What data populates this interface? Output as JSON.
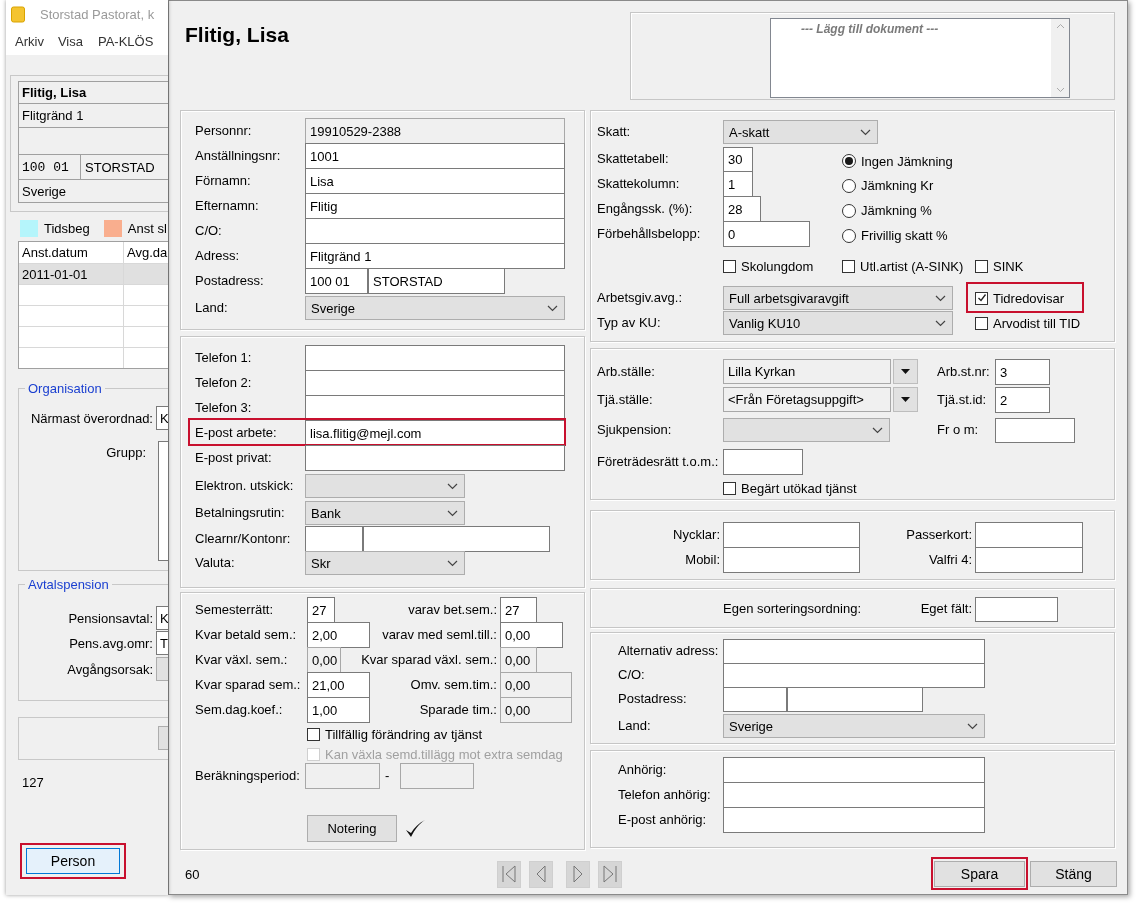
{
  "background_window": {
    "title": "Storstad Pastorat, k",
    "menu": [
      "Arkiv",
      "Visa",
      "PA-KLÖS"
    ],
    "address_card": {
      "name": "Flitig, Lisa",
      "street": "Flitgränd 1",
      "postcode": "100 01",
      "city": "STORSTAD",
      "country": "Sverige"
    },
    "legend": [
      {
        "label": "Tidsbeg",
        "color": "#b5f5fb"
      },
      {
        "label": "Anst sl",
        "color": "#f9ae8e"
      }
    ],
    "table": {
      "columns": [
        "Anst.datum",
        "Avg.da"
      ],
      "rows": [
        {
          "cells": [
            "2011-01-01"
          ],
          "selected": true
        }
      ]
    },
    "groups": [
      {
        "title": "Organisation",
        "fields": [
          {
            "label": "Närmast överordnad:",
            "kind": "text",
            "value": "K"
          },
          {
            "label": "Grupp:",
            "kind": "list"
          }
        ]
      },
      {
        "title": "Avtalspension",
        "fields": [
          {
            "label": "Pensionsavtal:",
            "kind": "text",
            "value": "K"
          },
          {
            "label": "Pens.avg.omr:",
            "kind": "text",
            "value": "T"
          },
          {
            "label": "Avgångsorsak:",
            "kind": "combo"
          }
        ]
      }
    ],
    "count": "127",
    "button": {
      "label": "Person",
      "highlighted": true
    }
  },
  "dialog": {
    "title": "Flitig, Lisa",
    "documents": [
      "--- Lägg till dokument ---"
    ],
    "left_panels": [
      {
        "rows": [
          {
            "items": [
              {
                "kind": "label",
                "text": "Personnr:"
              },
              {
                "kind": "readonly",
                "value": "19910529-2388"
              }
            ]
          },
          {
            "items": [
              {
                "kind": "label",
                "text": "Anställningsnr:"
              },
              {
                "kind": "text",
                "value": "1001"
              }
            ]
          },
          {
            "items": [
              {
                "kind": "label",
                "text": "Förnamn:"
              },
              {
                "kind": "text",
                "value": "Lisa"
              }
            ]
          },
          {
            "items": [
              {
                "kind": "label",
                "text": "Efternamn:"
              },
              {
                "kind": "text",
                "value": "Flitig"
              }
            ]
          },
          {
            "items": [
              {
                "kind": "label",
                "text": "C/O:"
              },
              {
                "kind": "text"
              }
            ]
          },
          {
            "items": [
              {
                "kind": "label",
                "text": "Adress:"
              },
              {
                "kind": "text",
                "value": "Flitgränd 1"
              }
            ]
          },
          {
            "items": [
              {
                "kind": "label",
                "text": "Postadress:"
              },
              {
                "kind": "text",
                "value": "100 01"
              },
              {
                "kind": "text",
                "value": "STORSTAD"
              }
            ]
          },
          {
            "items": [
              {
                "kind": "label",
                "text": "Land:"
              },
              {
                "kind": "combo",
                "value": "Sverige"
              }
            ]
          }
        ]
      },
      {
        "rows": [
          {
            "items": [
              {
                "kind": "label",
                "text": "Telefon 1:"
              },
              {
                "kind": "text"
              }
            ]
          },
          {
            "items": [
              {
                "kind": "label",
                "text": "Telefon 2:"
              },
              {
                "kind": "text"
              }
            ]
          },
          {
            "items": [
              {
                "kind": "label",
                "text": "Telefon 3:"
              },
              {
                "kind": "text"
              }
            ]
          },
          {
            "highlighted": true,
            "items": [
              {
                "kind": "label",
                "text": "E-post arbete:"
              },
              {
                "kind": "text",
                "value": "lisa.flitig@mejl.com"
              }
            ]
          },
          {
            "items": [
              {
                "kind": "label",
                "text": "E-post privat:"
              },
              {
                "kind": "text"
              }
            ]
          },
          {
            "items": [
              {
                "kind": "label",
                "text": "Elektron. utskick:"
              },
              {
                "kind": "combo"
              }
            ]
          },
          {
            "items": [
              {
                "kind": "label",
                "text": "Betalningsrutin:"
              },
              {
                "kind": "combo",
                "value": "Bank"
              }
            ]
          },
          {
            "items": [
              {
                "kind": "label",
                "text": "Clearnr/Kontonr:"
              },
              {
                "kind": "text"
              },
              {
                "kind": "text"
              }
            ]
          },
          {
            "items": [
              {
                "kind": "label",
                "text": "Valuta:"
              },
              {
                "kind": "combo",
                "value": "Skr"
              }
            ]
          }
        ]
      },
      {
        "rows": [
          {
            "items": [
              {
                "kind": "label",
                "text": "Semesterrätt:"
              },
              {
                "kind": "text",
                "value": "27"
              },
              {
                "kind": "label",
                "text": "varav bet.sem.:"
              },
              {
                "kind": "text",
                "value": "27"
              }
            ]
          },
          {
            "items": [
              {
                "kind": "label",
                "text": "Kvar betald sem.:"
              },
              {
                "kind": "text",
                "value": "2,00"
              },
              {
                "kind": "label",
                "text": "varav med seml.till.:"
              },
              {
                "kind": "text",
                "value": "0,00"
              }
            ]
          },
          {
            "items": [
              {
                "kind": "label",
                "text": "Kvar växl. sem.:"
              },
              {
                "kind": "readonly",
                "value": "0,00"
              },
              {
                "kind": "label",
                "text": "Kvar sparad växl. sem.:"
              },
              {
                "kind": "readonly",
                "value": "0,00"
              }
            ]
          },
          {
            "items": [
              {
                "kind": "label",
                "text": "Kvar sparad sem.:"
              },
              {
                "kind": "text",
                "value": "21,00"
              },
              {
                "kind": "label",
                "text": "Omv. sem.tim.:"
              },
              {
                "kind": "readonly",
                "value": "0,00"
              }
            ]
          },
          {
            "items": [
              {
                "kind": "label",
                "text": "Sem.dag.koef.:"
              },
              {
                "kind": "text",
                "value": "1,00"
              },
              {
                "kind": "label",
                "text": "Sparade tim.:"
              },
              {
                "kind": "readonly",
                "value": "0,00"
              }
            ]
          },
          {
            "items": [
              {
                "kind": "checkbox",
                "label": "Tillfällig förändring av tjänst",
                "checked": false,
                "disabled": false
              }
            ]
          },
          {
            "items": [
              {
                "kind": "checkbox",
                "label": "Kan växla semd.tillägg mot extra semdag",
                "checked": false,
                "disabled": true
              }
            ]
          },
          {
            "items": [
              {
                "kind": "label",
                "text": "Beräkningsperiod:"
              },
              {
                "kind": "readonly"
              },
              {
                "kind": "label",
                "text": "-"
              },
              {
                "kind": "readonly"
              }
            ]
          },
          {
            "items": [
              {
                "kind": "button",
                "label": "Notering",
                "noted": true
              }
            ]
          }
        ]
      }
    ],
    "right_panels": [
      {
        "rows": [
          {
            "items": [
              {
                "kind": "label",
                "text": "Skatt:"
              },
              {
                "kind": "combo",
                "value": "A-skatt"
              }
            ]
          },
          {
            "items": [
              {
                "kind": "label",
                "text": "Skattetabell:"
              },
              {
                "kind": "text",
                "value": "30"
              },
              {
                "kind": "radio",
                "label": "Ingen Jämkning",
                "selected": true
              }
            ]
          },
          {
            "items": [
              {
                "kind": "label",
                "text": "Skattekolumn:"
              },
              {
                "kind": "text",
                "value": "1"
              },
              {
                "kind": "radio",
                "label": "Jämkning Kr",
                "selected": false
              }
            ]
          },
          {
            "items": [
              {
                "kind": "label",
                "text": "Engångssk. (%):"
              },
              {
                "kind": "text",
                "value": "28"
              },
              {
                "kind": "radio",
                "label": "Jämkning %",
                "selected": false
              }
            ]
          },
          {
            "items": [
              {
                "kind": "label",
                "text": "Förbehållsbelopp:"
              },
              {
                "kind": "text",
                "value": "0"
              },
              {
                "kind": "radio",
                "label": "Frivillig skatt %",
                "selected": false
              }
            ]
          },
          {
            "items": [
              {
                "kind": "checkbox",
                "label": "Skolungdom",
                "checked": false,
                "disabled": false
              },
              {
                "kind": "checkbox",
                "label": "Utl.artist (A-SINK)",
                "checked": false,
                "disabled": false
              },
              {
                "kind": "checkbox",
                "label": "SINK",
                "checked": false,
                "disabled": false
              }
            ]
          },
          {
            "items": [
              {
                "kind": "label",
                "text": "Arbetsgiv.avg.:"
              },
              {
                "kind": "combo",
                "value": "Full arbetsgivaravgift"
              },
              {
                "kind": "checkbox",
                "label": "Tidredovisar",
                "checked": true,
                "disabled": false,
                "highlighted": true
              }
            ]
          },
          {
            "items": [
              {
                "kind": "label",
                "text": "Typ av KU:"
              },
              {
                "kind": "combo",
                "value": "Vanlig KU10"
              },
              {
                "kind": "checkbox",
                "label": "Arvodist till TID",
                "checked": false,
                "disabled": false
              }
            ]
          }
        ]
      },
      {
        "rows": [
          {
            "items": [
              {
                "kind": "label",
                "text": "Arb.ställe:"
              },
              {
                "kind": "picker",
                "value": "Lilla Kyrkan"
              },
              {
                "kind": "label",
                "text": "Arb.st.nr:"
              },
              {
                "kind": "text",
                "value": "3"
              }
            ]
          },
          {
            "items": [
              {
                "kind": "label",
                "text": "Tjä.ställe:"
              },
              {
                "kind": "picker",
                "value": "<Från Företagsuppgift>"
              },
              {
                "kind": "label",
                "text": "Tjä.st.id:"
              },
              {
                "kind": "text",
                "value": "2"
              }
            ]
          },
          {
            "items": [
              {
                "kind": "label",
                "text": "Sjukpension:"
              },
              {
                "kind": "combo"
              },
              {
                "kind": "label",
                "text": "Fr o m:"
              },
              {
                "kind": "text"
              }
            ]
          },
          {
            "items": [
              {
                "kind": "label",
                "text": "Företrädesrätt t.o.m.:"
              },
              {
                "kind": "text"
              }
            ]
          },
          {
            "items": [
              {
                "kind": "checkbox",
                "label": "Begärt utökad tjänst",
                "checked": false,
                "disabled": false
              }
            ]
          }
        ]
      },
      {
        "rows": [
          {
            "items": [
              {
                "kind": "label",
                "text": "Nycklar:"
              },
              {
                "kind": "text"
              },
              {
                "kind": "label",
                "text": "Passerkort:"
              },
              {
                "kind": "text"
              }
            ]
          },
          {
            "items": [
              {
                "kind": "label",
                "text": "Mobil:"
              },
              {
                "kind": "text"
              },
              {
                "kind": "label",
                "text": "Valfri 4:"
              },
              {
                "kind": "text"
              }
            ]
          }
        ]
      },
      {
        "rows": [
          {
            "items": [
              {
                "kind": "label",
                "text": "Egen sorteringsordning:"
              },
              {
                "kind": "label",
                "text": "Eget fält:"
              },
              {
                "kind": "text"
              }
            ]
          }
        ]
      },
      {
        "rows": [
          {
            "items": [
              {
                "kind": "label",
                "text": "Alternativ adress:"
              },
              {
                "kind": "text"
              }
            ]
          },
          {
            "items": [
              {
                "kind": "label",
                "text": "C/O:"
              },
              {
                "kind": "text"
              }
            ]
          },
          {
            "items": [
              {
                "kind": "label",
                "text": "Postadress:"
              },
              {
                "kind": "text"
              },
              {
                "kind": "text"
              }
            ]
          },
          {
            "items": [
              {
                "kind": "label",
                "text": "Land:"
              },
              {
                "kind": "combo",
                "value": "Sverige"
              }
            ]
          }
        ]
      },
      {
        "rows": [
          {
            "items": [
              {
                "kind": "label",
                "text": "Anhörig:"
              },
              {
                "kind": "text"
              }
            ]
          },
          {
            "items": [
              {
                "kind": "label",
                "text": "Telefon anhörig:"
              },
              {
                "kind": "text"
              }
            ]
          },
          {
            "items": [
              {
                "kind": "label",
                "text": "E-post anhörig:"
              },
              {
                "kind": "text"
              }
            ]
          }
        ]
      }
    ],
    "footer": {
      "record_number": "60",
      "nav_buttons": [
        {
          "kind": "first"
        },
        {
          "kind": "previous"
        },
        {
          "kind": "next"
        },
        {
          "kind": "last"
        }
      ],
      "buttons": [
        {
          "label": "Spara",
          "highlighted": true
        },
        {
          "label": "Stäng",
          "highlighted": false
        }
      ]
    }
  }
}
